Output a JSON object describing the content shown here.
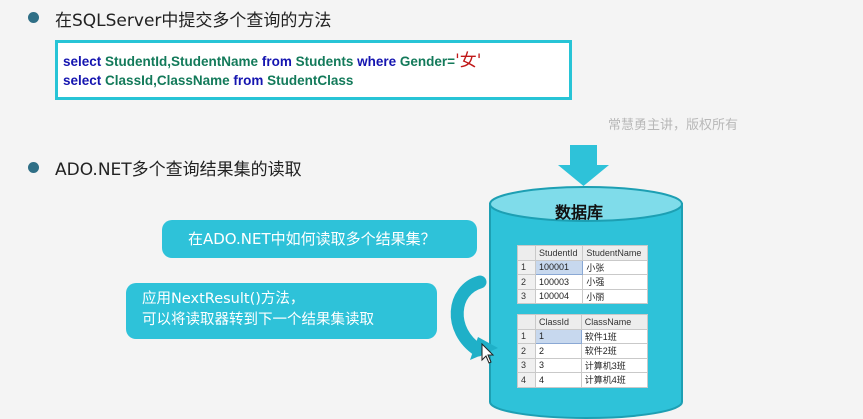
{
  "section1": {
    "heading": "在SQLServer中提交多个查询的方法",
    "code": {
      "line1": {
        "kw_select": "select",
        "columns": "StudentId,StudentName",
        "kw_from": "from",
        "table": "Students",
        "kw_where": "where",
        "condition": "Gender=",
        "value": "'女'"
      },
      "line2": {
        "kw_select": "select",
        "columns": "ClassId,ClassName",
        "kw_from": "from",
        "table": "StudentClass"
      }
    }
  },
  "watermark": "常慧勇主讲，版权所有",
  "section2": {
    "heading": "ADO.NET多个查询结果集的读取"
  },
  "callout_question": "在ADO.NET中如何读取多个结果集？",
  "callout_answer": {
    "line1": "应用NextResult()方法，",
    "line2": "可以将读取器转到下一个结果集读取"
  },
  "database": {
    "label": "数据库",
    "table1": {
      "headers": [
        "StudentId",
        "StudentName"
      ],
      "rows": [
        {
          "n": "1",
          "c1": "100001",
          "c2": "小张"
        },
        {
          "n": "2",
          "c1": "100003",
          "c2": "小强"
        },
        {
          "n": "3",
          "c1": "100004",
          "c2": "小丽"
        }
      ]
    },
    "table2": {
      "headers": [
        "ClassId",
        "ClassName"
      ],
      "rows": [
        {
          "n": "1",
          "c1": "1",
          "c2": "软件1班"
        },
        {
          "n": "2",
          "c1": "2",
          "c2": "软件2班"
        },
        {
          "n": "3",
          "c1": "3",
          "c2": "计算机3班"
        },
        {
          "n": "4",
          "c1": "4",
          "c2": "计算机4班"
        }
      ]
    }
  },
  "colors": {
    "accent": "#2ec2d9",
    "box_border": "#27c4d6",
    "keyword": "#1515b0",
    "identifier": "#137a5a",
    "string": "#c01818"
  }
}
